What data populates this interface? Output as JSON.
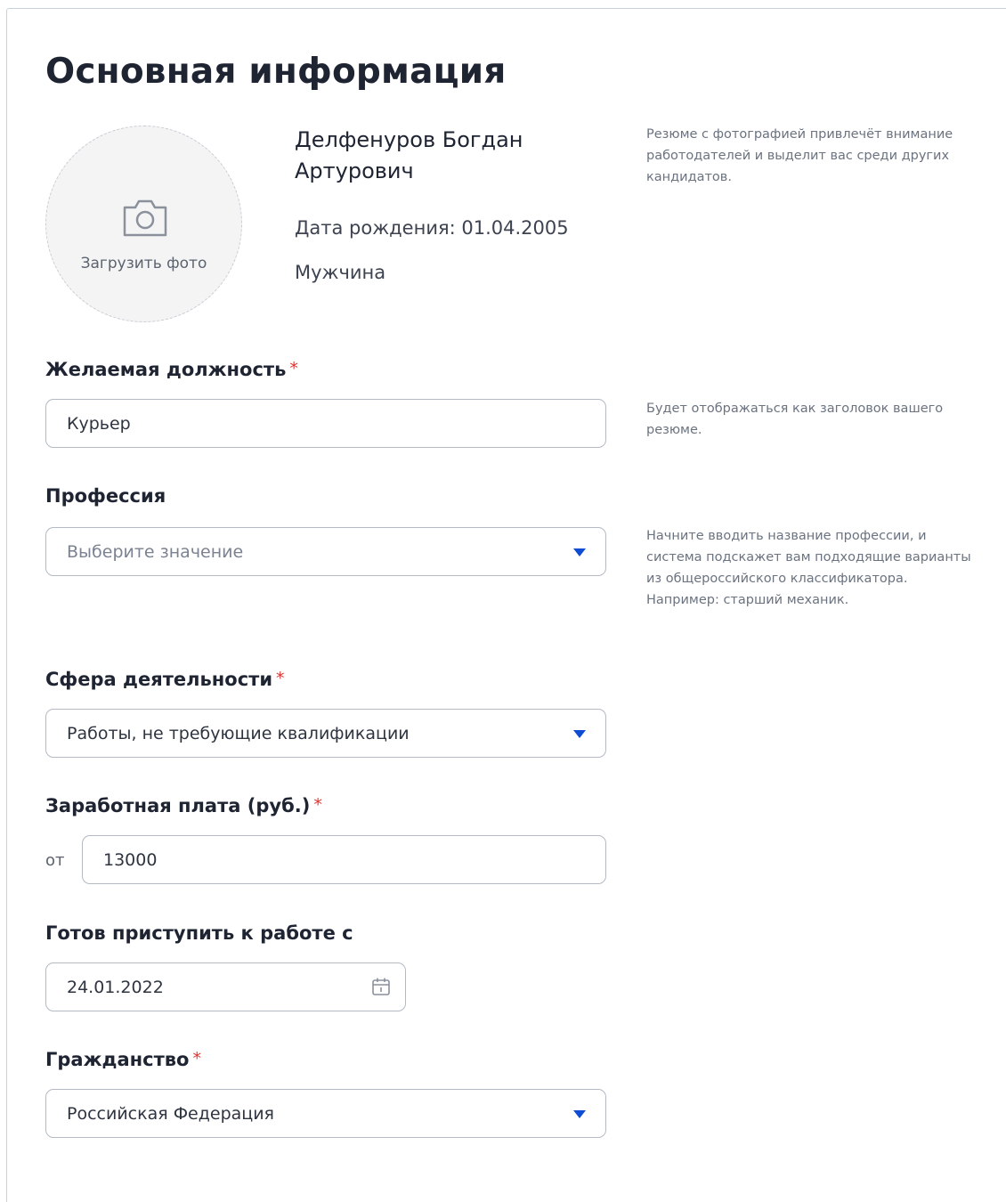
{
  "page_title": "Основная информация",
  "photo": {
    "upload_label": "Загрузить фото",
    "hint": "Резюме с фотографией привлечёт внимание работодателей и выделит вас среди других кандидатов."
  },
  "person": {
    "full_name": "Делфенуров Богдан Артурович",
    "birth_date": "Дата рождения: 01.04.2005",
    "gender": "Мужчина"
  },
  "desired_position": {
    "label": "Желаемая должность",
    "required_mark": "*",
    "value": "Курьер",
    "hint": "Будет отображаться как заголовок вашего резюме."
  },
  "profession": {
    "label": "Профессия",
    "placeholder": "Выберите значение",
    "hint": "Начните вводить название профессии, и система подскажет вам подходящие варианты из общероссийского классификатора. Например: старший механик."
  },
  "field_of_activity": {
    "label": "Сфера деятельности",
    "required_mark": "*",
    "value": "Работы, не требующие квалификации"
  },
  "salary": {
    "label": "Заработная плата (руб.)",
    "required_mark": "*",
    "from_label": "от",
    "value": "13000"
  },
  "start_date": {
    "label": "Готов приступить к работе с",
    "value": "24.01.2022"
  },
  "citizenship": {
    "label": "Гражданство",
    "required_mark": "*",
    "value": "Российская Федерация"
  },
  "colors": {
    "accent": "#0d4cd3",
    "required": "#e0332f",
    "border": "#b3bac4"
  },
  "icons": [
    "camera-icon",
    "chevron-down-icon",
    "calendar-icon"
  ]
}
